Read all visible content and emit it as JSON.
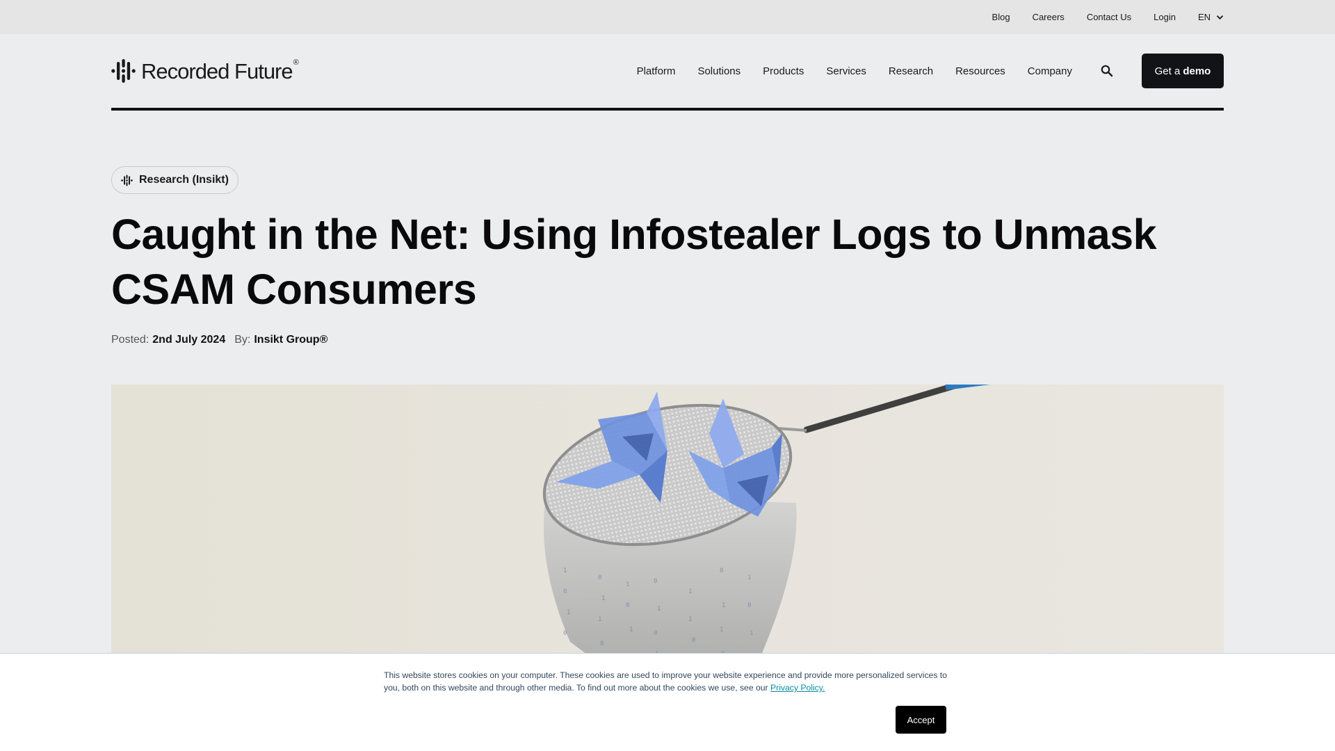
{
  "utility_bar": {
    "links": [
      {
        "label": "Blog"
      },
      {
        "label": "Careers"
      },
      {
        "label": "Contact Us"
      },
      {
        "label": "Login"
      }
    ],
    "language": {
      "selected": "EN",
      "icon": "chevron-down-icon"
    }
  },
  "header": {
    "logo_text": "Recorded Future",
    "logo_mark": "®",
    "nav": [
      {
        "label": "Platform"
      },
      {
        "label": "Solutions"
      },
      {
        "label": "Products"
      },
      {
        "label": "Services"
      },
      {
        "label": "Research"
      },
      {
        "label": "Resources"
      },
      {
        "label": "Company"
      }
    ],
    "search_icon": "search-icon",
    "cta": {
      "prefix": "Get a",
      "emphasis": "demo"
    }
  },
  "article": {
    "category": "Research (Insikt)",
    "title": "Caught in the Net: Using Infostealer Logs to Unmask CSAM Consumers",
    "posted_label": "Posted:",
    "posted_date": "2nd July 2024",
    "by_label": "By:",
    "author": "Insikt Group®",
    "hero_image": {
      "description": "Origami blue birds caught in a butterfly net dripping binary digits",
      "colors": {
        "background": "#e6e2da",
        "bird": "#6f93e0",
        "net": "#bdbdbd"
      }
    }
  },
  "cookie_banner": {
    "text": "This website stores cookies on your computer. These cookies are used to improve your website experience and provide more personalized services to you, both on this website and through other media. To find out more about the cookies we use, see our",
    "link_label": "Privacy Policy.",
    "accept_label": "Accept"
  },
  "colors": {
    "page_background": "#ecedef",
    "utility_bar": "#e5e5e5",
    "cta_background": "#121317",
    "link_accent": "#0b8ca0"
  }
}
